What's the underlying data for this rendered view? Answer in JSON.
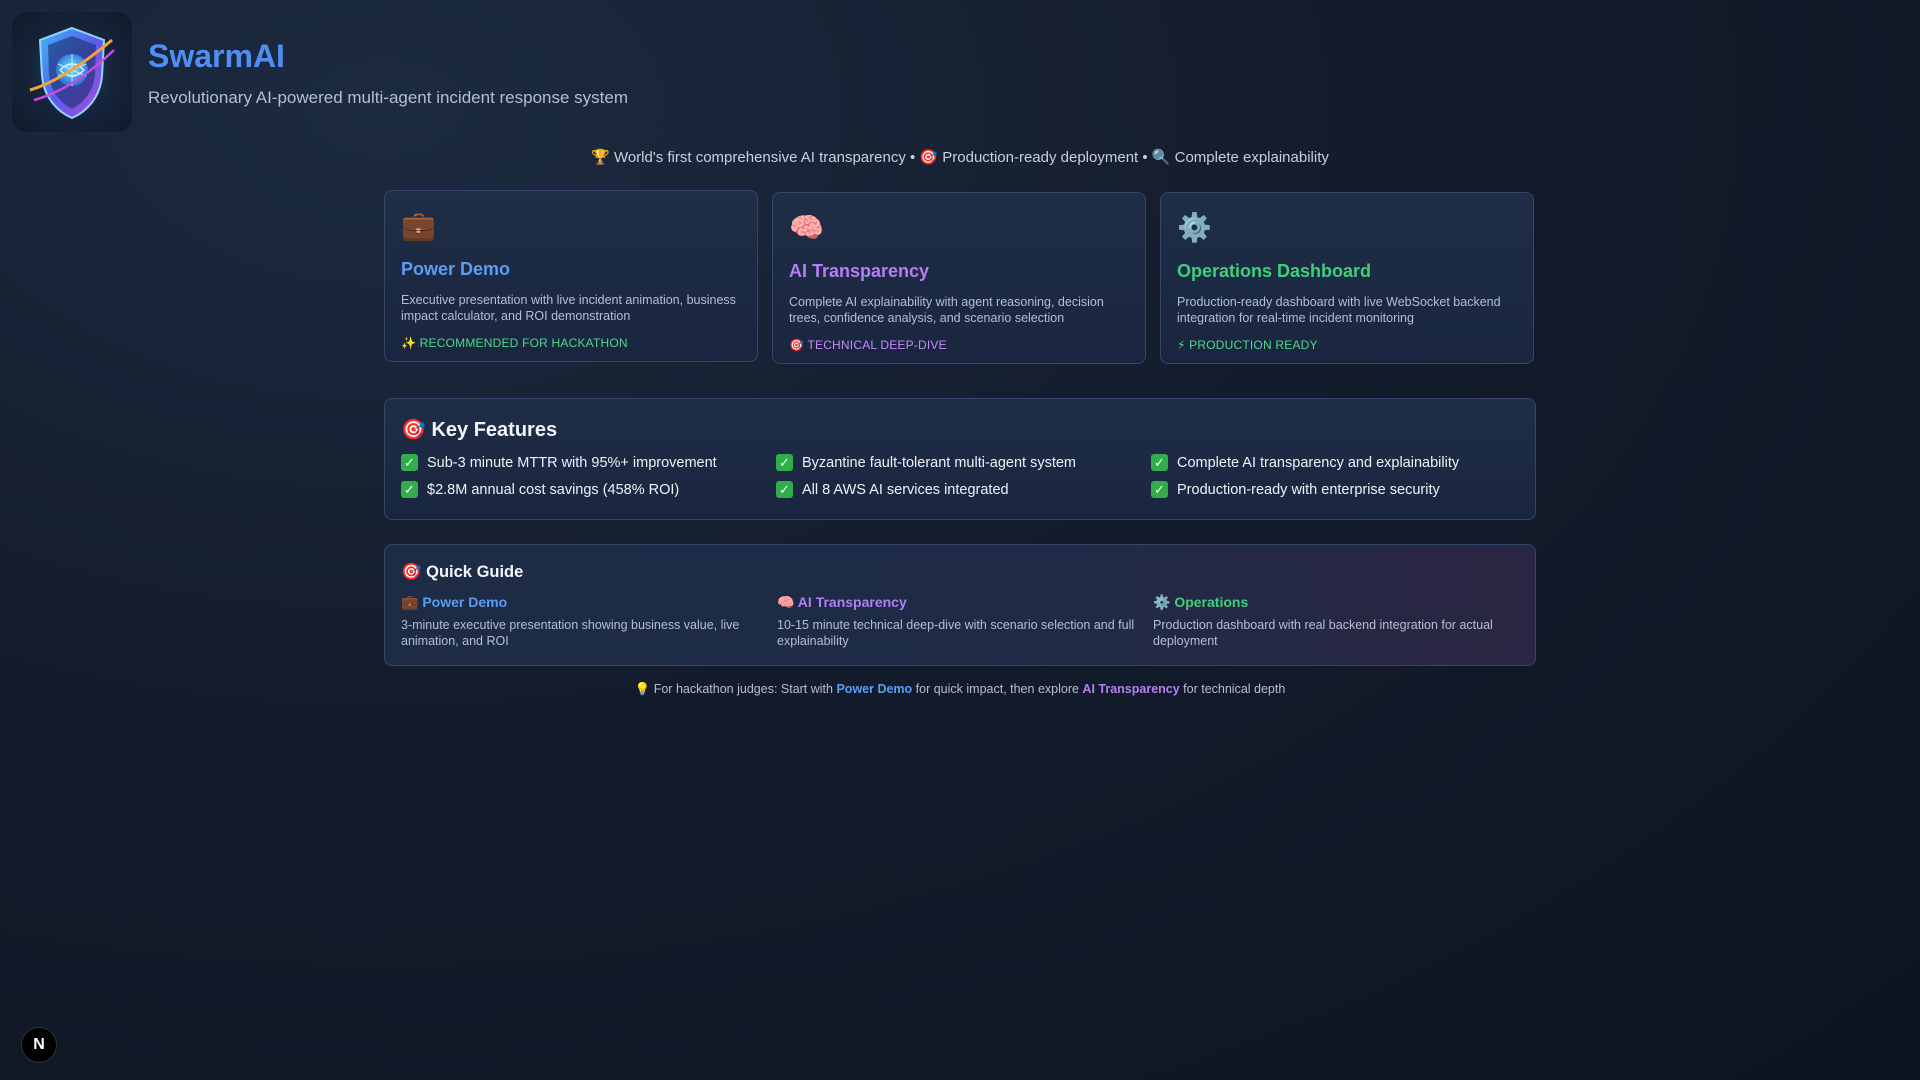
{
  "header": {
    "title": "SwarmAI",
    "subtitle": "Revolutionary AI-powered multi-agent incident response system",
    "tagline": "🏆 World's first comprehensive AI transparency • 🎯 Production-ready deployment • 🔍 Complete explainability"
  },
  "cards": [
    {
      "icon": "💼",
      "icon_name": "briefcase-icon",
      "title": "Power Demo",
      "title_color": "#5b9cf5",
      "description": "Executive presentation with live incident animation, business impact calculator, and ROI demonstration",
      "badge": "✨ RECOMMENDED FOR HACKATHON",
      "badge_color": "#4fd88a"
    },
    {
      "icon": "🧠",
      "icon_name": "brain-icon",
      "title": "AI Transparency",
      "title_color": "#b47ef5",
      "description": "Complete AI explainability with agent reasoning, decision trees, confidence analysis, and scenario selection",
      "badge": "🎯 TECHNICAL DEEP-DIVE",
      "badge_color": "#c58af7"
    },
    {
      "icon": "⚙️",
      "icon_name": "gear-icon",
      "title": "Operations Dashboard",
      "title_color": "#3fcf7a",
      "description": "Production-ready dashboard with live WebSocket backend integration for real-time incident monitoring",
      "badge": "⚡ PRODUCTION READY",
      "badge_color": "#4fd88a"
    }
  ],
  "key_features": {
    "title": "🎯 Key Features",
    "items": [
      "Sub-3 minute MTTR with 95%+ improvement",
      "Byzantine fault-tolerant multi-agent system",
      "Complete AI transparency and explainability",
      "$2.8M annual cost savings (458% ROI)",
      "All 8 AWS AI services integrated",
      "Production-ready with enterprise security"
    ]
  },
  "quick_guide": {
    "title": "🎯 Quick Guide",
    "items": [
      {
        "heading": "💼 Power Demo",
        "color": "#5b9cf5",
        "description": "3-minute executive presentation showing business value, live animation, and ROI"
      },
      {
        "heading": "🧠 AI Transparency",
        "color": "#b47ef5",
        "description": "10-15 minute technical deep-dive with scenario selection and full explainability"
      },
      {
        "heading": "⚙️ Operations",
        "color": "#3fcf7a",
        "description": "Production dashboard with real backend integration for actual deployment"
      }
    ]
  },
  "hint": {
    "prefix": "💡 For hackathon judges: Start with ",
    "link1": "Power Demo",
    "middle": " for quick impact, then explore ",
    "link2": "AI Transparency",
    "suffix": " for technical depth"
  },
  "dev_badge": {
    "label": "N"
  }
}
